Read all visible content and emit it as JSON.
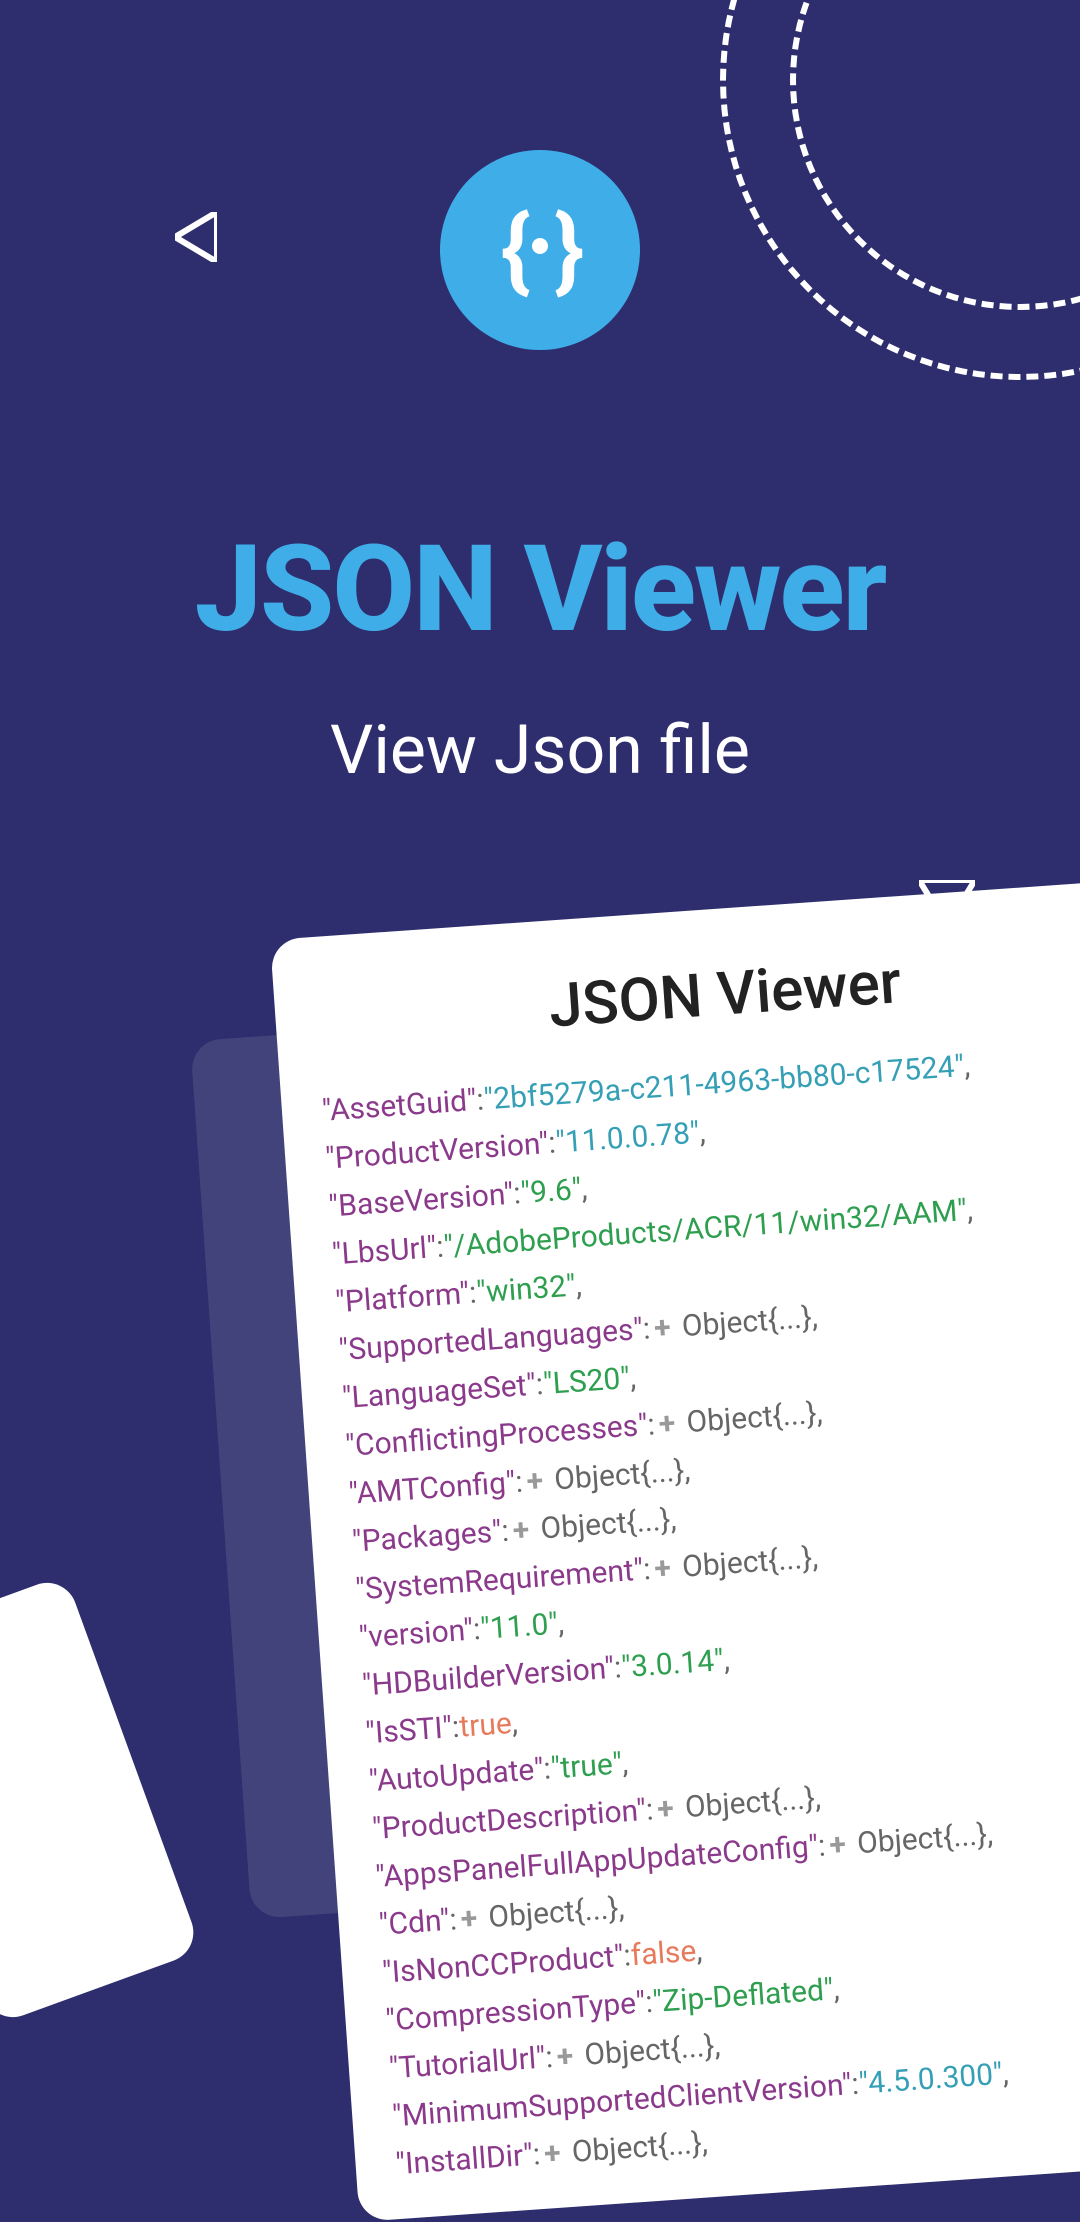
{
  "header": {
    "title": "JSON Viewer",
    "subtitle": "View Json file"
  },
  "card": {
    "title": "JSON Viewer",
    "lines": [
      {
        "key": "AssetGuid",
        "type": "number",
        "value": "2bf5279a-c211-4963-bb80-c17524"
      },
      {
        "key": "ProductVersion",
        "type": "number",
        "value": "11.0.0.78"
      },
      {
        "key": "BaseVersion",
        "type": "string",
        "value": "9.6"
      },
      {
        "key": "LbsUrl",
        "type": "string",
        "value": "/AdobeProducts/ACR/11/win32/AAM"
      },
      {
        "key": "Platform",
        "type": "string",
        "value": "win32"
      },
      {
        "key": "SupportedLanguages",
        "type": "object"
      },
      {
        "key": "LanguageSet",
        "type": "string",
        "value": "LS20"
      },
      {
        "key": "ConflictingProcesses",
        "type": "object"
      },
      {
        "key": "AMTConfig",
        "type": "object"
      },
      {
        "key": "Packages",
        "type": "object"
      },
      {
        "key": "SystemRequirement",
        "type": "object"
      },
      {
        "key": "version",
        "type": "string",
        "value": "11.0"
      },
      {
        "key": "HDBuilderVersion",
        "type": "string",
        "value": "3.0.14"
      },
      {
        "key": "IsSTI",
        "type": "bool",
        "value": "true"
      },
      {
        "key": "AutoUpdate",
        "type": "string",
        "value": "true"
      },
      {
        "key": "ProductDescription",
        "type": "object"
      },
      {
        "key": "AppsPanelFullAppUpdateConfig",
        "type": "object"
      },
      {
        "key": "Cdn",
        "type": "object"
      },
      {
        "key": "IsNonCCProduct",
        "type": "bool",
        "value": "false"
      },
      {
        "key": "CompressionType",
        "type": "string",
        "value": "Zip-Deflated"
      },
      {
        "key": "TutorialUrl",
        "type": "object"
      },
      {
        "key": "MinimumSupportedClientVersion",
        "type": "number",
        "value": "4.5.0.300"
      },
      {
        "key": "InstallDir",
        "type": "object"
      }
    ]
  }
}
